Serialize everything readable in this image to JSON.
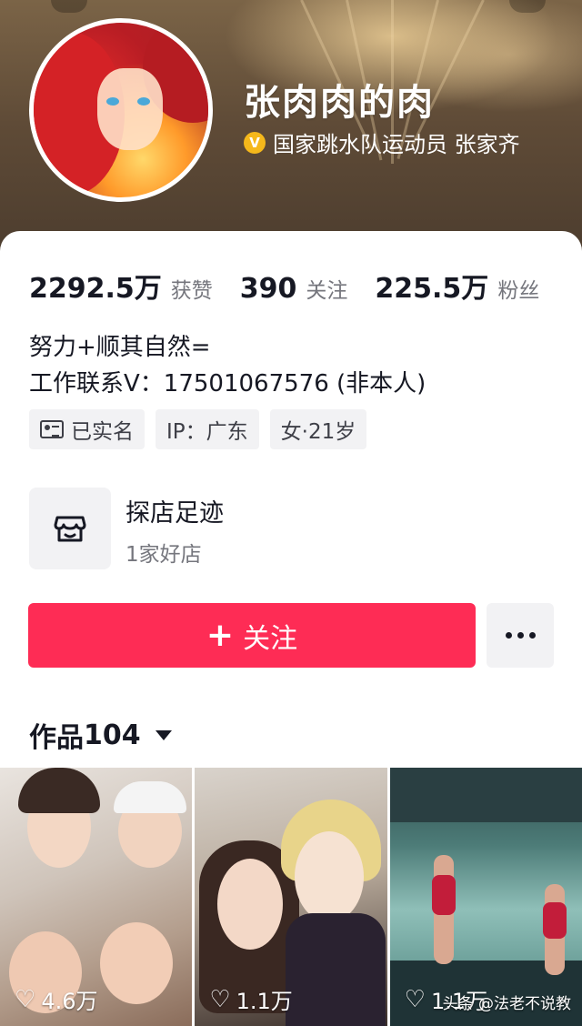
{
  "profile": {
    "nickname": "张肉肉的肉",
    "verify_badge": "V",
    "verify_text": "国家跳水队运动员 张家齐"
  },
  "stats": [
    {
      "value": "2292.5万",
      "label": "获赞"
    },
    {
      "value": "390",
      "label": "关注"
    },
    {
      "value": "225.5万",
      "label": "粉丝"
    }
  ],
  "bio": {
    "line1": "努力+顺其自然=",
    "line2": "工作联系V：17501067576 (非本人)"
  },
  "tags": {
    "verified": "已实名",
    "ip": "IP：广东",
    "gender_age": "女·21岁"
  },
  "shop": {
    "title": "探店足迹",
    "subtitle": "1家好店"
  },
  "actions": {
    "follow_icon": "+",
    "follow_label": "关注"
  },
  "works": {
    "label": "作品",
    "count": "104"
  },
  "videos": [
    {
      "likes": "4.6万",
      "icon": "heart-icon"
    },
    {
      "likes": "1.1万",
      "icon": "heart-icon"
    },
    {
      "likes": "1.1万",
      "icon": "heart-icon"
    }
  ],
  "watermark": "头条 @法老不说教",
  "colors": {
    "accent": "#fe2c55",
    "verify_gold": "#f5b81b",
    "text_primary": "#161823",
    "text_secondary": "#75767d",
    "tag_bg": "#f2f2f4"
  }
}
